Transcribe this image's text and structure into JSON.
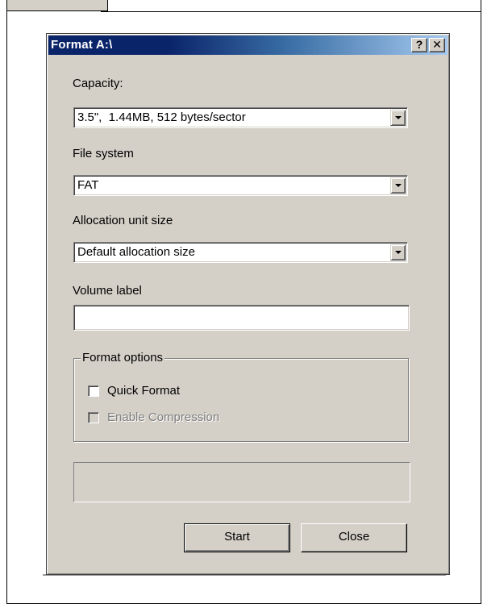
{
  "window": {
    "title": "Format A:\\",
    "help_glyph": "?",
    "close_glyph": "✕"
  },
  "capacity": {
    "label": "Capacity:",
    "value": "3.5\",  1.44MB, 512 bytes/sector"
  },
  "file_system": {
    "label": "File system",
    "value": "FAT"
  },
  "allocation": {
    "label": "Allocation unit size",
    "value": "Default allocation size"
  },
  "volume_label": {
    "label": "Volume label",
    "value": ""
  },
  "format_options": {
    "legend": "Format options",
    "quick_format": {
      "label": "Quick Format",
      "checked": false,
      "enabled": true
    },
    "enable_compression": {
      "label": "Enable Compression",
      "checked": false,
      "enabled": false
    }
  },
  "progress": {
    "fraction": 0
  },
  "buttons": {
    "start": "Start",
    "close": "Close"
  },
  "colors": {
    "titlebar_active": "#0a246a",
    "dialog_face": "#d4d0c8"
  }
}
